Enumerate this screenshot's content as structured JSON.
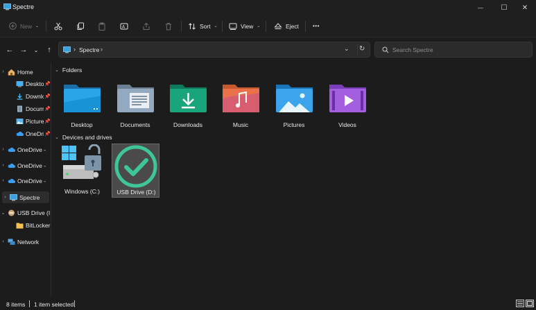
{
  "window": {
    "title": "Spectre",
    "controls": {
      "minimize": "—",
      "maximize": "☐",
      "close": "✕"
    }
  },
  "toolbar": {
    "new_label": "New",
    "sort_label": "Sort",
    "view_label": "View",
    "eject_label": "Eject",
    "more_label": "•••"
  },
  "address": {
    "path_segments": [
      "Spectre"
    ],
    "separator": "›",
    "search_placeholder": "Search Spectre"
  },
  "sidebar": {
    "items": [
      {
        "label": "Home",
        "icon": "home-icon",
        "expandable": true,
        "pinned": false
      },
      {
        "label": "Desktop",
        "icon": "desktop-folder-icon",
        "expandable": false,
        "pinned": true
      },
      {
        "label": "Downloads",
        "icon": "downloads-folder-icon",
        "expandable": false,
        "pinned": true
      },
      {
        "label": "Documents",
        "icon": "documents-folder-icon",
        "expandable": false,
        "pinned": true
      },
      {
        "label": "Pictures",
        "icon": "pictures-folder-icon",
        "expandable": false,
        "pinned": true
      },
      {
        "label": "OneDrive",
        "icon": "onedrive-cloud-icon",
        "expandable": false,
        "pinned": true
      },
      {
        "label": "OneDrive -",
        "icon": "onedrive-cloud-icon",
        "expandable": true,
        "pinned": false
      },
      {
        "label": "OneDrive -",
        "icon": "onedrive-cloud-icon",
        "expandable": true,
        "pinned": false
      },
      {
        "label": "OneDrive -",
        "icon": "onedrive-cloud-icon",
        "expandable": true,
        "pinned": false
      },
      {
        "label": "Spectre",
        "icon": "computer-icon",
        "expandable": true,
        "pinned": false,
        "selected": true
      },
      {
        "label": "USB Drive (I",
        "icon": "usb-drive-icon",
        "expandable": true,
        "pinned": false
      },
      {
        "label": "BitLocker",
        "icon": "folder-icon",
        "expandable": false,
        "pinned": false
      },
      {
        "label": "Network",
        "icon": "network-icon",
        "expandable": true,
        "pinned": false
      }
    ]
  },
  "main": {
    "folders_header": "Folders",
    "folders": [
      {
        "label": "Desktop",
        "icon": "desktop-folder-icon"
      },
      {
        "label": "Documents",
        "icon": "documents-folder-icon"
      },
      {
        "label": "Downloads",
        "icon": "downloads-folder-icon"
      },
      {
        "label": "Music",
        "icon": "music-folder-icon"
      },
      {
        "label": "Pictures",
        "icon": "pictures-folder-icon"
      },
      {
        "label": "Videos",
        "icon": "videos-folder-icon"
      }
    ],
    "drives_header": "Devices and drives",
    "drives": [
      {
        "label": "Windows (C:)",
        "icon": "bitlocker-unlocked-drive-icon",
        "selected": false
      },
      {
        "label": "USB Drive (D:)",
        "icon": "checkmark-circle-icon",
        "selected": true
      }
    ]
  },
  "status": {
    "items_count": "8 items",
    "selected_count": "1 item selected"
  },
  "colors": {
    "background": "#1c1c1c",
    "accent": "#4cc2ff",
    "selection": "#4a4a4a",
    "check_green": "#3ec59a"
  }
}
